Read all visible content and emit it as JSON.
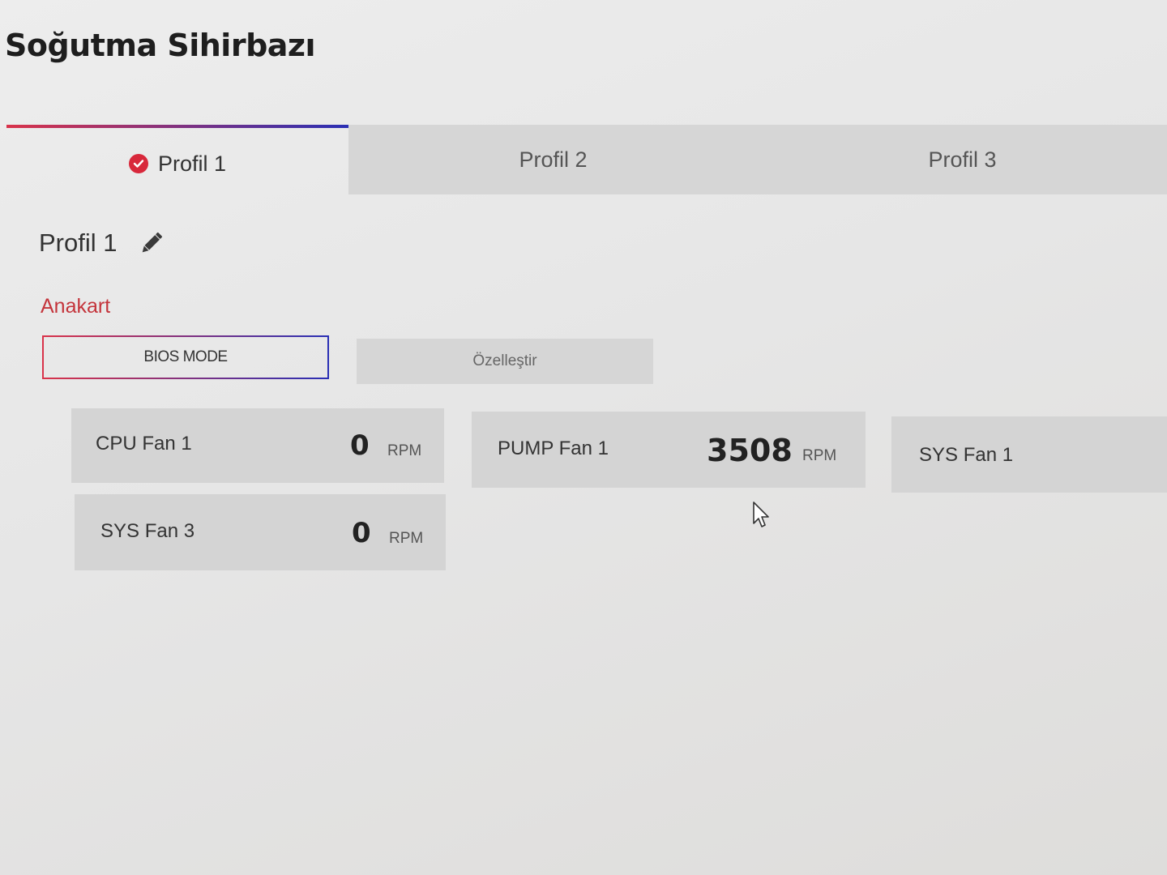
{
  "app": {
    "title": "Soğutma Sihirbazı"
  },
  "tabs": [
    {
      "label": "Profil 1",
      "active": true
    },
    {
      "label": "Profil 2",
      "active": false
    },
    {
      "label": "Profil 3",
      "active": false
    }
  ],
  "profile": {
    "name": "Profil 1",
    "edit_icon": "pencil-icon"
  },
  "section": {
    "label": "Anakart"
  },
  "modes": {
    "bios_label": "BIOS MODE",
    "custom_label": "Özelleştir",
    "selected": "BIOS MODE"
  },
  "fans": [
    {
      "name": "CPU Fan 1",
      "value": "0",
      "unit": "RPM"
    },
    {
      "name": "PUMP Fan 1",
      "value": "3508",
      "unit": "RPM"
    },
    {
      "name": "SYS Fan 1"
    },
    {
      "name": "SYS Fan 3",
      "value": "0",
      "unit": "RPM"
    }
  ],
  "colors": {
    "accent_red": "#d8283b",
    "accent_blue": "#2a2fb4",
    "section_label": "#c4343b",
    "card_bg": "#d4d4d4"
  }
}
